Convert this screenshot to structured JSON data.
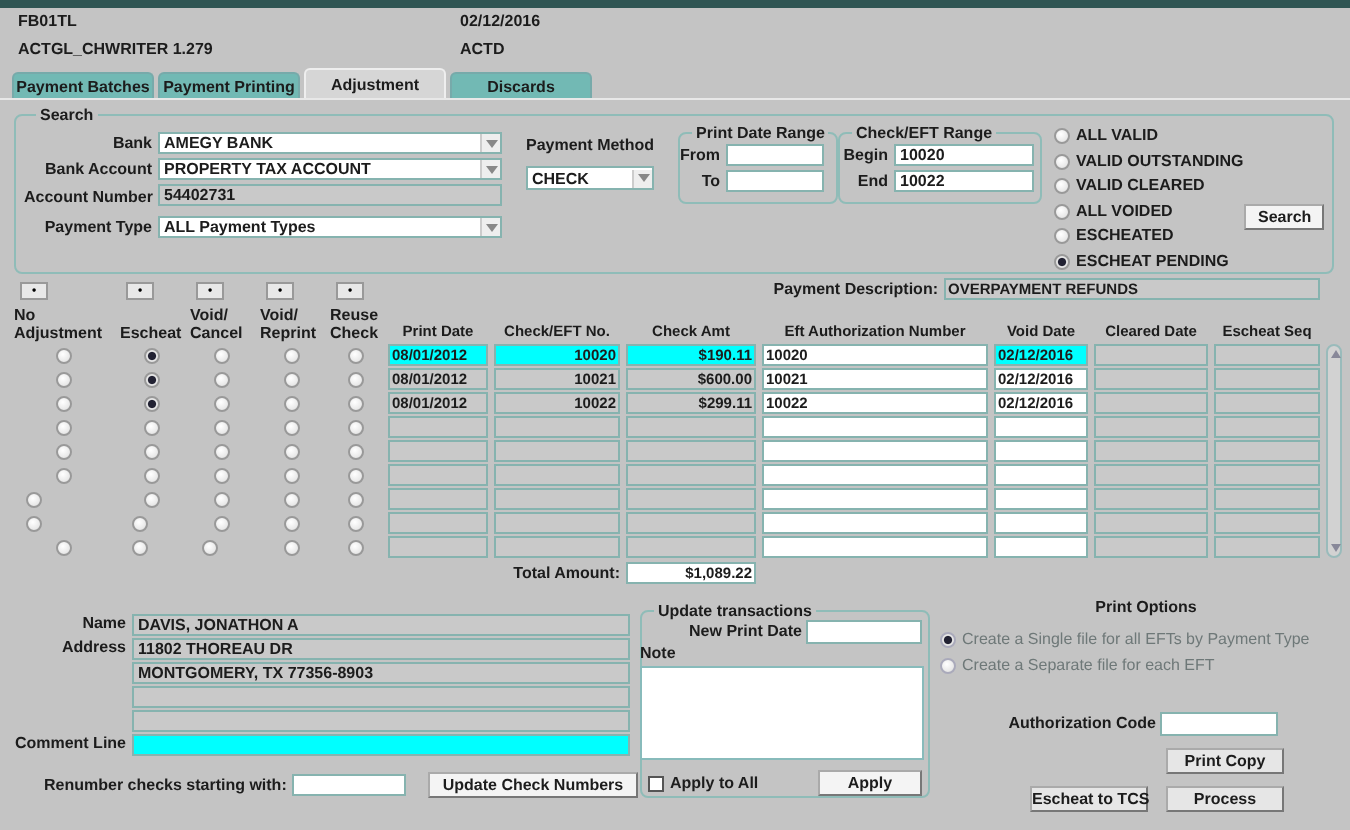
{
  "header": {
    "form_code": "FB01TL",
    "date": "02/12/2016",
    "program": "ACTGL_CHWRITER 1.279",
    "status": "ACTD"
  },
  "tabs": [
    {
      "label": "Payment Batches",
      "selected": false
    },
    {
      "label": "Payment Printing",
      "selected": false
    },
    {
      "label": "Adjustment",
      "selected": true
    },
    {
      "label": "Discards",
      "selected": false
    }
  ],
  "search": {
    "title": "Search",
    "fields": [
      {
        "label": "Bank",
        "value": "AMEGY BANK",
        "kind": "dropdown"
      },
      {
        "label": "Bank Account",
        "value": "PROPERTY TAX ACCOUNT",
        "kind": "dropdown"
      },
      {
        "label": "Account Number",
        "value": "54402731",
        "kind": "display"
      },
      {
        "label": "Payment Type",
        "value": "ALL Payment Types",
        "kind": "dropdown"
      }
    ],
    "payment_method": {
      "label": "Payment Method",
      "value": "CHECK"
    },
    "print_date_range": {
      "title": "Print Date Range",
      "from_label": "From",
      "to_label": "To"
    },
    "check_range": {
      "title": "Check/EFT Range",
      "begin_label": "Begin",
      "begin": "10020",
      "end_label": "End",
      "end": "10022"
    },
    "status_options": [
      {
        "label": "ALL VALID",
        "selected": false
      },
      {
        "label": "VALID OUTSTANDING",
        "selected": false
      },
      {
        "label": "VALID CLEARED",
        "selected": false
      },
      {
        "label": "ALL VOIDED",
        "selected": false
      },
      {
        "label": "ESCHEATED",
        "selected": false
      },
      {
        "label": "ESCHEAT PENDING",
        "selected": true
      }
    ],
    "search_button": "Search"
  },
  "payment_description": {
    "label": "Payment Description:",
    "value": "OVERPAYMENT REFUNDS"
  },
  "table": {
    "action_columns": [
      {
        "button": "•",
        "label": "No Adjustment"
      },
      {
        "button": "•",
        "label": "Escheat"
      },
      {
        "button": "•",
        "label": "Void/ Cancel"
      },
      {
        "button": "•",
        "label": "Void/ Reprint"
      },
      {
        "button": "•",
        "label": "Reuse Check"
      }
    ],
    "columns": [
      {
        "label": "Print Date",
        "kind": "display",
        "highlight_on_current": true
      },
      {
        "label": "Check/EFT No.",
        "kind": "number",
        "highlight_on_current": true
      },
      {
        "label": "Check Amt",
        "kind": "number",
        "highlight_on_current": true
      },
      {
        "label": "Eft Authorization Number",
        "kind": "entry",
        "highlight_on_current": false
      },
      {
        "label": "Void Date",
        "kind": "entry",
        "highlight_on_current": true
      },
      {
        "label": "Cleared Date",
        "kind": "display",
        "highlight_on_current": false
      },
      {
        "label": "Escheat Seq",
        "kind": "display",
        "highlight_on_current": false
      }
    ],
    "rows": [
      {
        "current": true,
        "choices": [
          {
            "selected": false
          },
          {
            "selected": true
          },
          {
            "selected": false
          },
          {
            "selected": false
          },
          {
            "selected": false
          }
        ],
        "cells": [
          "08/01/2012",
          "10020",
          "$190.11",
          "10020",
          "02/12/2016"
        ]
      },
      {
        "current": false,
        "choices": [
          {
            "selected": false
          },
          {
            "selected": true
          },
          {
            "selected": false
          },
          {
            "selected": false
          },
          {
            "selected": false
          }
        ],
        "cells": [
          "08/01/2012",
          "10021",
          "$600.00",
          "10021",
          "02/12/2016"
        ]
      },
      {
        "current": false,
        "choices": [
          {
            "selected": false
          },
          {
            "selected": true
          },
          {
            "selected": false
          },
          {
            "selected": false
          },
          {
            "selected": false
          }
        ],
        "cells": [
          "08/01/2012",
          "10022",
          "$299.11",
          "10022",
          "02/12/2016"
        ]
      },
      {
        "current": false,
        "choices": [
          {
            "selected": false
          },
          {
            "selected": false
          },
          {
            "selected": false
          },
          {
            "selected": false
          },
          {
            "selected": false
          }
        ]
      },
      {
        "current": false,
        "choices": [
          {
            "selected": false
          },
          {
            "selected": false
          },
          {
            "selected": false
          },
          {
            "selected": false
          },
          {
            "selected": false
          }
        ]
      },
      {
        "current": false,
        "choices": [
          {
            "selected": false
          },
          {
            "selected": false
          },
          {
            "selected": false
          },
          {
            "selected": false
          },
          {
            "selected": false
          }
        ]
      },
      {
        "current": false,
        "choices": [
          {
            "selected": false
          },
          {
            "selected": false
          },
          {
            "selected": false
          },
          {
            "selected": false
          },
          {
            "selected": false
          }
        ]
      },
      {
        "current": false,
        "choices": [
          {
            "selected": false
          },
          {
            "selected": false
          },
          {
            "selected": false
          },
          {
            "selected": false
          },
          {
            "selected": false
          }
        ]
      },
      {
        "current": false,
        "choices": [
          {
            "selected": false
          },
          {
            "selected": false
          },
          {
            "selected": false
          },
          {
            "selected": false
          },
          {
            "selected": false
          }
        ]
      }
    ],
    "total_label": "Total Amount:",
    "total": "$1,089.22"
  },
  "payee": {
    "name_label": "Name",
    "name": "DAVIS, JONATHON A",
    "address_label": "Address",
    "address_lines": [
      "11802 THOREAU DR",
      "MONTGOMERY, TX 77356-8903"
    ],
    "comment_label": "Comment Line",
    "comment_highlighted": true
  },
  "renumber": {
    "label": "Renumber checks starting with:",
    "button": "Update Check Numbers"
  },
  "update_transactions": {
    "title": "Update transactions",
    "new_print_date_label": "New Print Date",
    "note_label": "Note",
    "apply_to_all": {
      "label": "Apply to All",
      "checked": false
    },
    "apply_button": "Apply"
  },
  "print_options": {
    "title": "Print Options",
    "options": [
      {
        "label": "Create a Single file for all EFTs by Payment Type",
        "selected": true,
        "disabled": true
      },
      {
        "label": "Create a Separate file for each EFT",
        "selected": false,
        "disabled": true
      }
    ]
  },
  "authorization_code_label": "Authorization Code",
  "buttons": {
    "print_copy": "Print Copy",
    "escheat": "Escheat to TCS",
    "process": "Process"
  }
}
